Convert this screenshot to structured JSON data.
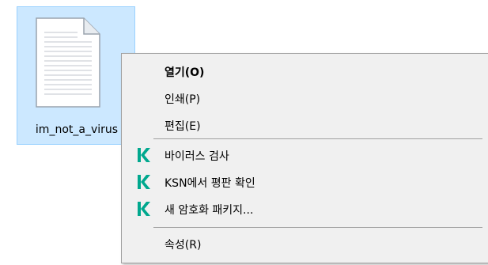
{
  "file": {
    "name": "im_not_a_virus",
    "icon": "document-icon",
    "selected": true
  },
  "context_menu": {
    "items": [
      {
        "label": "열기(O)",
        "default": true
      },
      {
        "label": "인쇄(P)"
      },
      {
        "label": "편집(E)"
      },
      {
        "label": "바이러스 검사",
        "icon": "kaspersky-k-icon"
      },
      {
        "label": "KSN에서 평판 확인",
        "icon": "kaspersky-k-icon"
      },
      {
        "label": "새 암호화 패키지...",
        "icon": "kaspersky-k-icon"
      },
      {
        "label": "속성(R)"
      }
    ]
  },
  "colors": {
    "selection_bg": "#cce8ff",
    "selection_border": "#99d1ff",
    "menu_bg": "#f0f0f0",
    "kaspersky_green": "#00a88e"
  }
}
